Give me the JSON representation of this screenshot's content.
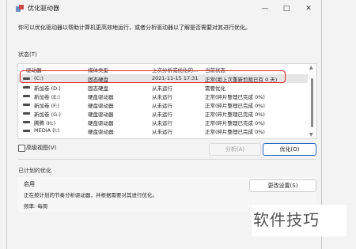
{
  "window": {
    "title": "优化驱动器",
    "controls": [
      "—",
      "□",
      "✕"
    ]
  },
  "description": "你可以优化驱动器以帮助计算机更高效地运行，或者分析驱动器以了解是否需要对其进行优化。",
  "status": {
    "label": "状态(T)",
    "columns": [
      "驱动器",
      "媒体类型",
      "上次分析或优化的...",
      "当前状态"
    ],
    "rows": [
      {
        "drive": "(C:)",
        "media": "固态硬盘",
        "last": "2021-11-15 17:31",
        "status": "正常(距上次重新剪裁已有 0 天)",
        "selected": true
      },
      {
        "drive": "新加卷 (D:)",
        "media": "固态硬盘",
        "last": "从未运行",
        "status": "需要优化",
        "selected": false
      },
      {
        "drive": "新加卷 (E:)",
        "media": "硬盘驱动器",
        "last": "从未运行",
        "status": "正常(碎片整理已完成 0%)",
        "selected": false
      },
      {
        "drive": "新加卷 (F:)",
        "media": "硬盘驱动器",
        "last": "从未运行",
        "status": "正常(碎片整理已完成 0%)",
        "selected": false
      },
      {
        "drive": "新加卷 (G:)",
        "media": "硬盘驱动器",
        "last": "从未运行",
        "status": "正常(碎片整理已完成 0%)",
        "selected": false
      },
      {
        "drive": "腾腾 (H:)",
        "media": "硬盘驱动器",
        "last": "从未运行",
        "status": "正常(碎片整理已完成 0%)",
        "selected": false
      },
      {
        "drive": "MEDIA (I:)",
        "media": "硬盘驱动器",
        "last": "从未运行",
        "status": "正常(碎片整理已完成 0%)",
        "selected": false
      }
    ]
  },
  "advanced_view": "高级视图(V)",
  "buttons": {
    "analyze": "分析(A)",
    "optimize": "优化(O)",
    "change_settings": "更改设置(S)"
  },
  "scheduled": {
    "label": "已计划的优化",
    "state": "启用",
    "info": "正在按计划的节奏分析驱动器，并根据需要对其进行优化。",
    "frequency": "频率: 每周"
  },
  "watermark": "软件技巧"
}
